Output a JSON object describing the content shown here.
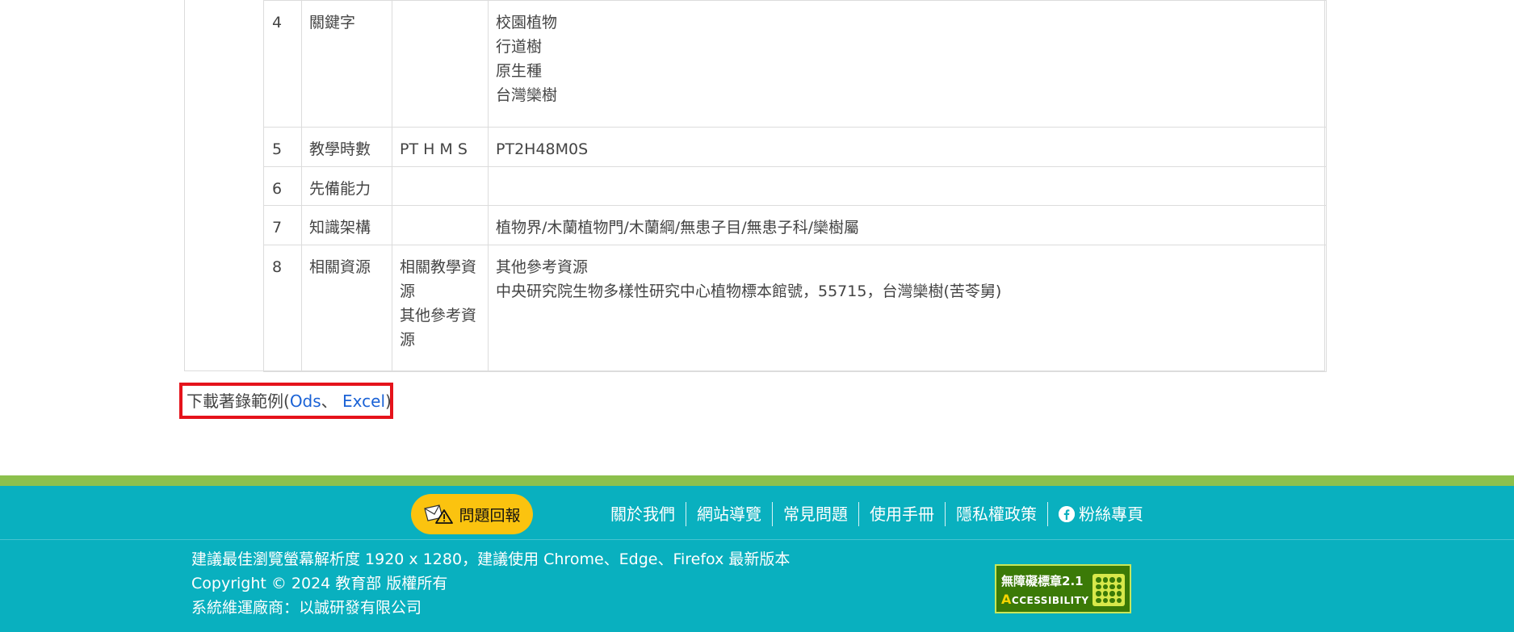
{
  "table": {
    "rows": [
      {
        "num": "4",
        "label": "關鍵字",
        "sub": [],
        "value": [
          "校園植物",
          "行道樹",
          "原生種",
          "台灣欒樹"
        ]
      },
      {
        "num": "5",
        "label": "教學時數",
        "sub": [
          "PT H M S"
        ],
        "value": [
          "PT2H48M0S"
        ]
      },
      {
        "num": "6",
        "label": "先備能力",
        "sub": [],
        "value": []
      },
      {
        "num": "7",
        "label": "知識架構",
        "sub": [],
        "value": [
          "植物界/木蘭植物門/木蘭綱/無患子目/無患子科/欒樹屬"
        ]
      },
      {
        "num": "8",
        "label": "相關資源",
        "sub": [
          "相關教學資源",
          "其他參考資源"
        ],
        "value": [
          "其他參考資源",
          "中央研究院生物多樣性研究中心植物標本館號，55715，台灣欒樹(苦苓舅)"
        ]
      }
    ]
  },
  "download": {
    "prefix": "下載著錄範例(",
    "ods": "Ods",
    "sep": "、 ",
    "excel": "Excel",
    "suffix": ")"
  },
  "footer": {
    "report_button": "問題回報",
    "nav": [
      "關於我們",
      "網站導覽",
      "常見問題",
      "使用手冊",
      "隱私權政策",
      "粉絲專頁"
    ],
    "resolution_note": "建議最佳瀏覽螢幕解析度 1920 x 1280，建議使用 Chrome、Edge、Firefox 最新版本",
    "copyright": "Copyright © 2024 教育部 版權所有",
    "vendor": "系統維運廠商：以誠研發有限公司",
    "badge_line1": "無障礙標章2.1",
    "badge_line2_a": "A",
    "badge_line2_b": "CCESSIBILITY"
  },
  "colors": {
    "footer_bg": "#09b0bf",
    "footer_stripe": "#8cc04c",
    "report_button_bg": "#fbc30f",
    "link": "#1a62d6",
    "highlight_border": "#e5131b"
  },
  "icons": {
    "report": "mail-warning-icon",
    "facebook": "facebook-icon"
  }
}
